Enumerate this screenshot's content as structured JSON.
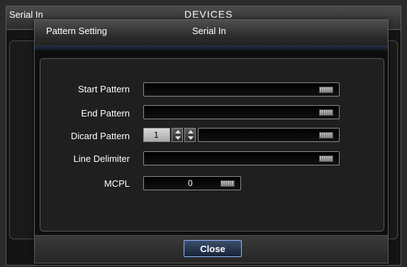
{
  "background_window": {
    "left_label": "Serial In",
    "title": "DEVICES"
  },
  "dialog": {
    "title_left": "Pattern Setting",
    "title_center": "Serial In",
    "fields": {
      "start_pattern": {
        "label": "Start Pattern",
        "value": ""
      },
      "end_pattern": {
        "label": "End Pattern",
        "value": ""
      },
      "dicard_pattern": {
        "label": "Dicard Pattern",
        "count": "1",
        "value": ""
      },
      "line_delimiter": {
        "label": "Line Delimiter",
        "value": ""
      },
      "mcpl": {
        "label": "MCPL",
        "value": "0"
      }
    },
    "close_label": "Close"
  },
  "icons": [
    "keyboard-icon",
    "spin-up-icon",
    "spin-down-icon"
  ],
  "colors": {
    "accent_border": "#8fb3ff",
    "title_bar": "#3a3a3a",
    "panel_bg": "#1f1f1f"
  }
}
